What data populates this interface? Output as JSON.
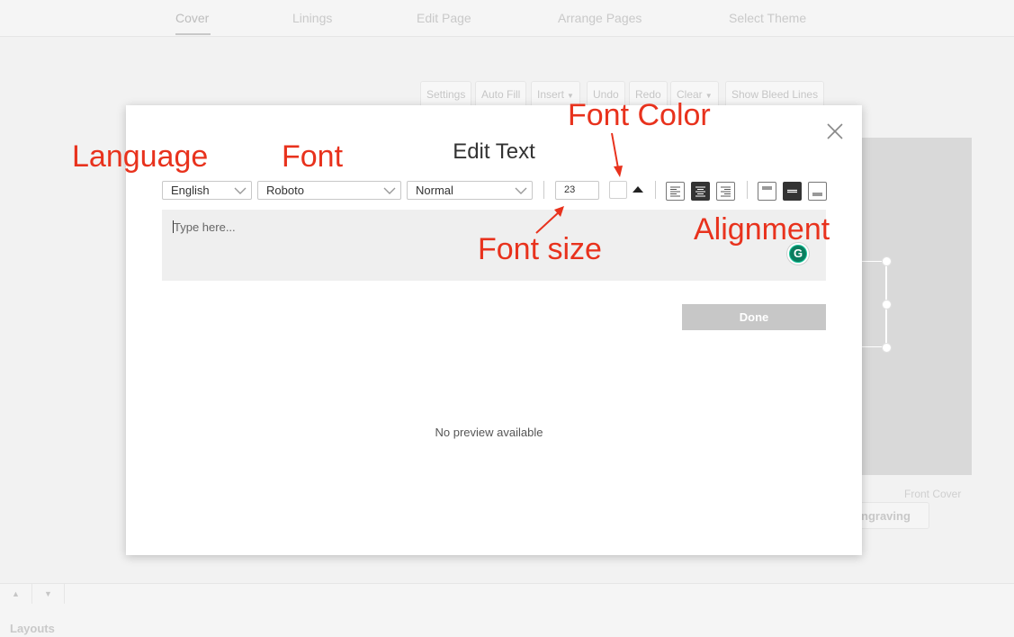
{
  "nav": {
    "tabs": [
      "Cover",
      "Linings",
      "Edit Page",
      "Arrange Pages",
      "Select Theme"
    ],
    "active_tab": "Cover"
  },
  "toolbar": {
    "settings": "Settings",
    "auto_fill": "Auto Fill",
    "insert": "Insert",
    "undo": "Undo",
    "redo": "Redo",
    "clear": "Clear",
    "show_bleed_lines": "Show Bleed Lines"
  },
  "cover": {
    "front_cover_label": "Front Cover",
    "engraving_button": "ngraving"
  },
  "bottom": {
    "layouts_label": "Layouts"
  },
  "modal": {
    "title": "Edit Text",
    "language": "English",
    "font": "Roboto",
    "style": "Normal",
    "font_size": "23",
    "font_color": "#ffffff",
    "text_placeholder": "Type here...",
    "text_value": "",
    "done_label": "Done",
    "preview_text": "No preview available",
    "active_text_align": "center",
    "active_vertical_align": "middle"
  },
  "annotations": {
    "language": "Language",
    "font": "Font",
    "font_color": "Font Color",
    "font_size": "Font size",
    "alignment": "Alignment"
  },
  "colors": {
    "annotation": "#e8321d",
    "done_button": "#c7c7c7",
    "grammarly": "#15c39a"
  }
}
